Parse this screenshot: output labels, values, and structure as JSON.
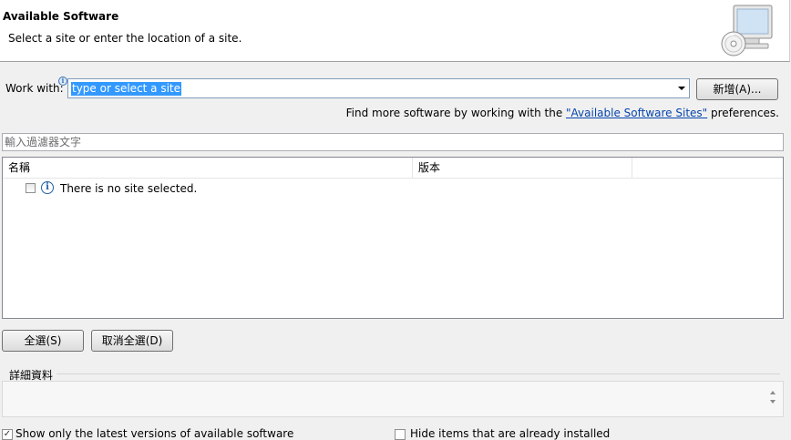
{
  "header": {
    "title": "Available Software",
    "description": "Select a site or enter the location of a site."
  },
  "work_with": {
    "label": "Work with:",
    "value": "type or select a site",
    "add_button": "新增(A)..."
  },
  "find_more": {
    "prefix": "Find more software by working with the ",
    "link": "\"Available Software Sites\"",
    "suffix": " preferences."
  },
  "filter": {
    "placeholder": "輸入過濾器文字"
  },
  "table": {
    "columns": [
      "名稱",
      "版本"
    ],
    "rows": [
      {
        "text": "There is no site selected."
      }
    ]
  },
  "buttons": {
    "select_all": "全選(S)",
    "deselect_all": "取消全選(D)"
  },
  "details": {
    "label": "詳細資料"
  },
  "options": {
    "option1": "Show only the latest versions of available software",
    "option2": "Hide items that are already installed"
  },
  "colors": {
    "selection": "#3399ff",
    "link": "#0645ad",
    "info_icon": "#1f5fa7"
  },
  "icons": {
    "banner": "monitor-cd-icon",
    "info": "info-icon",
    "dropdown": "chevron-down-icon"
  }
}
